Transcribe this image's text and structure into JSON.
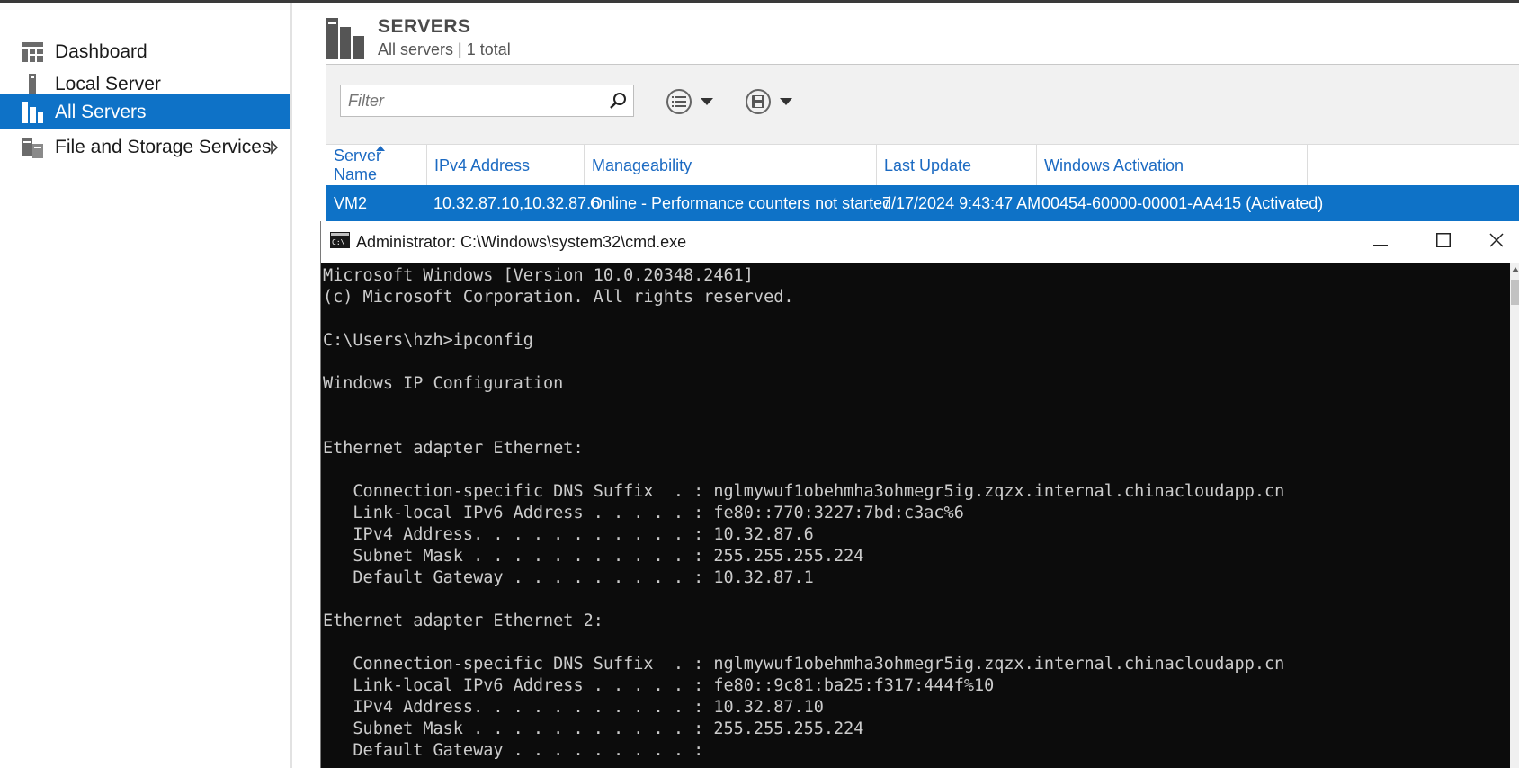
{
  "sidebar": {
    "items": [
      {
        "label": "Dashboard",
        "icon": "dashboard-icon"
      },
      {
        "label": "Local Server",
        "icon": "server-icon"
      },
      {
        "label": "All Servers",
        "icon": "all-servers-icon",
        "active": true
      },
      {
        "label": "File and Storage Services",
        "icon": "storage-icon",
        "has_submenu": true
      }
    ]
  },
  "header": {
    "title": "SERVERS",
    "subtitle": "All servers | 1 total"
  },
  "panel": {
    "filter_placeholder": "Filter",
    "columns": [
      "Server Name",
      "IPv4 Address",
      "Manageability",
      "Last Update",
      "Windows Activation"
    ],
    "sorted_column": "Server Name",
    "rows": [
      {
        "server_name": "VM2",
        "ipv4": "10.32.87.10,10.32.87.6",
        "manageability": "Online - Performance counters not started",
        "last_update": "7/17/2024 9:43:47 AM",
        "activation": "00454-60000-00001-AA415 (Activated)"
      }
    ]
  },
  "cmd": {
    "title": "Administrator: C:\\Windows\\system32\\cmd.exe",
    "lines": [
      "Microsoft Windows [Version 10.0.20348.2461]",
      "(c) Microsoft Corporation. All rights reserved.",
      "",
      "C:\\Users\\hzh>ipconfig",
      "",
      "Windows IP Configuration",
      "",
      "",
      "Ethernet adapter Ethernet:",
      "",
      "   Connection-specific DNS Suffix  . : nglmywuf1obehmha3ohmegr5ig.zqzx.internal.chinacloudapp.cn",
      "   Link-local IPv6 Address . . . . . : fe80::770:3227:7bd:c3ac%6",
      "   IPv4 Address. . . . . . . . . . . : 10.32.87.6",
      "   Subnet Mask . . . . . . . . . . . : 255.255.255.224",
      "   Default Gateway . . . . . . . . . : 10.32.87.1",
      "",
      "Ethernet adapter Ethernet 2:",
      "",
      "   Connection-specific DNS Suffix  . : nglmywuf1obehmha3ohmegr5ig.zqzx.internal.chinacloudapp.cn",
      "   Link-local IPv6 Address . . . . . : fe80::9c81:ba25:f317:444f%10",
      "   IPv4 Address. . . . . . . . . . . : 10.32.87.10",
      "   Subnet Mask . . . . . . . . . . . : 255.255.255.224",
      "   Default Gateway . . . . . . . . . :"
    ]
  },
  "colors": {
    "accent": "#0e72c7",
    "link": "#1b6ac2",
    "console_bg": "#0c0c0c",
    "console_fg": "#cccccc"
  }
}
